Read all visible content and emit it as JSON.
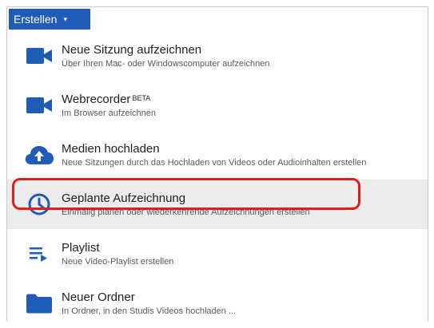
{
  "toolbar": {
    "create_label": "Erstellen",
    "create_caret": "▾"
  },
  "menu": {
    "items": [
      {
        "title": "Neue Sitzung aufzeichnen",
        "subtitle": "Über Ihren Mac- oder Windowscomputer aufzeichnen",
        "icon": "video-camera-icon"
      },
      {
        "title": "Webrecorder",
        "badge": "BETA",
        "subtitle": "Im Browser aufzeichnen",
        "icon": "video-camera-icon"
      },
      {
        "title": "Medien hochladen",
        "subtitle": "Neue Sitzungen durch das Hochladen von Videos oder Audioinhalten erstellen",
        "icon": "cloud-upload-icon"
      },
      {
        "title": "Geplante Aufzeichnung",
        "subtitle": "Einmalig planen oder wiederkehrende Aufzeichnungen erstellen",
        "icon": "clock-icon",
        "highlighted": true
      },
      {
        "title": "Playlist",
        "subtitle": "Neue Video-Playlist erstellen",
        "icon": "playlist-icon"
      },
      {
        "title": "Neuer Ordner",
        "subtitle": "In Ordner, in den Studis Videos hochladen ...",
        "icon": "folder-icon"
      }
    ]
  },
  "colors": {
    "accent": "#1f5cb8",
    "icon": "#1f5cb8",
    "highlight_bg": "#ececec",
    "callout": "#e11c1c"
  }
}
